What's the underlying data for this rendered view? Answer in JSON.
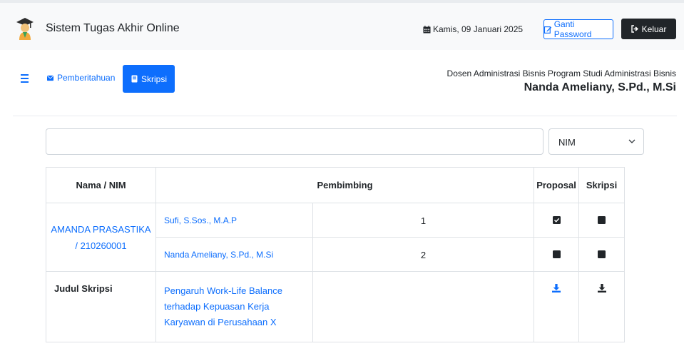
{
  "header": {
    "app_title": "Sistem Tugas Akhir Online",
    "date": "Kamis, 09 Januari 2025",
    "change_password_label": "Ganti Password",
    "logout_label": "Keluar"
  },
  "nav": {
    "notifications_label": "Pemberitahuan",
    "thesis_label": "Skripsi"
  },
  "user": {
    "role": "Dosen Administrasi Bisnis Program Studi Administrasi Bisnis",
    "name": "Nanda Ameliany, S.Pd., M.Si"
  },
  "search": {
    "value": "",
    "filter_selected": "NIM"
  },
  "table": {
    "headers": {
      "name": "Nama / NIM",
      "supervisor": "Pembimbing",
      "proposal": "Proposal",
      "thesis": "Skripsi"
    },
    "student": "AMANDA PRASASTIKA / 210260001",
    "supervisors": [
      {
        "name": "Sufi, S.Sos., M.A.P",
        "order": "1",
        "proposal": "checked",
        "thesis": "unchecked"
      },
      {
        "name": "Nanda Ameliany, S.Pd., M.Si",
        "order": "2",
        "proposal": "unchecked",
        "thesis": "unchecked"
      }
    ],
    "title_label": "Judul Skripsi",
    "title_value": "Pengaruh Work-Life Balance terhadap Kepuasan Kerja Karyawan di Perusahaan X"
  },
  "colors": {
    "primary": "#0d6efd",
    "dark": "#212529",
    "topbar": "#f8f9fa"
  },
  "icons": {
    "logo": "graduate-icon",
    "calendar": "calendar-icon",
    "edit": "edit-icon",
    "logout": "logout-icon",
    "menu": "hamburger-icon",
    "envelope": "envelope-icon",
    "book": "book-icon",
    "download": "download-icon"
  }
}
